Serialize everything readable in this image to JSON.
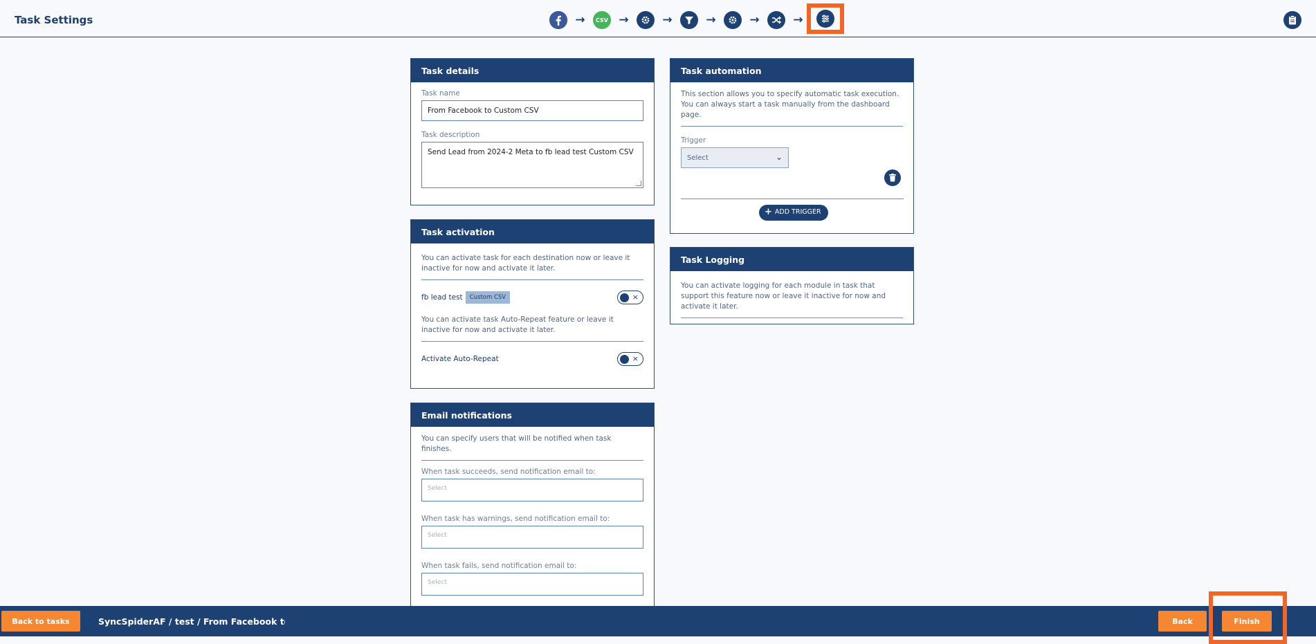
{
  "header": {
    "title": "Task Settings",
    "steps": [
      {
        "name": "facebook-icon"
      },
      {
        "name": "csv-icon",
        "label": "CSV"
      },
      {
        "name": "gear-icon"
      },
      {
        "name": "filter-icon"
      },
      {
        "name": "gear-icon"
      },
      {
        "name": "shuffle-icon"
      },
      {
        "name": "settings-sliders-icon",
        "active": true
      }
    ],
    "right_icon": "clipboard-icon"
  },
  "task_details": {
    "heading": "Task details",
    "name_label": "Task name",
    "name_value": "From Facebook to Custom CSV",
    "desc_label": "Task description",
    "desc_value": "Send Lead from 2024-2 Meta to fb lead test Custom CSV"
  },
  "task_activation": {
    "heading": "Task activation",
    "note1": "You can activate task for each destination now or leave it inactive for now and activate it later.",
    "dest_label": "fb lead test",
    "dest_tag": "Custom CSV",
    "note2": "You can activate task Auto-Repeat feature or leave it inactive for now and activate it later.",
    "auto_repeat_label": "Activate Auto-Repeat",
    "toggle_off_symbol": "×"
  },
  "email_notifications": {
    "heading": "Email notifications",
    "note": "You can specify users that will be notified when task finishes.",
    "success_label": "When task succeeds, send notification email to:",
    "warnings_label": "When task has warnings, send notification email to:",
    "fails_label": "When task fails, send notification email to:",
    "placeholder": "Select"
  },
  "task_automation": {
    "heading": "Task automation",
    "note": "This section allows you to specify automatic task execution. You can always start a task manually from the dashboard page.",
    "trigger_label": "Trigger",
    "trigger_value": "Select",
    "add_trigger": "ADD TRIGGER"
  },
  "task_logging": {
    "heading": "Task Logging",
    "note": "You can activate logging for each module in task that support this feature now or leave it inactive for now and activate it later."
  },
  "footer": {
    "back_to_tasks": "Back to tasks",
    "breadcrumb": "SyncSpiderAF / test / From Facebook to Custom CSV",
    "back": "Back",
    "finish": "Finish"
  },
  "colors": {
    "primary": "#1e4173",
    "accent": "#f58733",
    "highlight": "#f26522"
  }
}
